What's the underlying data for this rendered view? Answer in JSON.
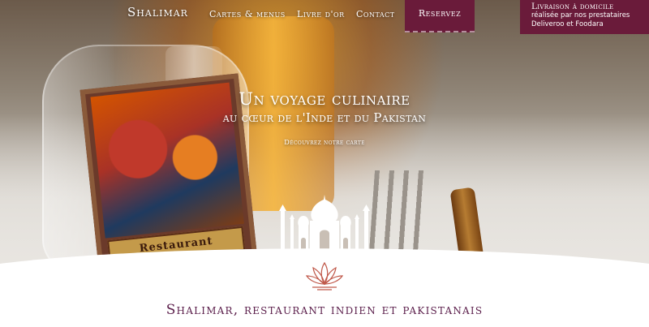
{
  "nav": {
    "logo": "Shalimar",
    "links": [
      "Cartes & menus",
      "Livre d'or",
      "Contact"
    ],
    "reserve_label": "Reservez"
  },
  "delivery": {
    "title": "Livraison à domicile",
    "line1": "réalisée par nos prestataires",
    "line2": "Deliveroo et Foodara"
  },
  "hero": {
    "title": "Un voyage culinaire",
    "subtitle": "au cœur de l'Inde et du Pakistan",
    "cta": "Découvrez notre carte",
    "menu_card_text": "Restaurant"
  },
  "section": {
    "title": "Shalimar, restaurant indien et pakistanais"
  },
  "colors": {
    "brand": "#6a1b3a",
    "title": "#5a1d4a",
    "lotus": "#c0594a"
  }
}
